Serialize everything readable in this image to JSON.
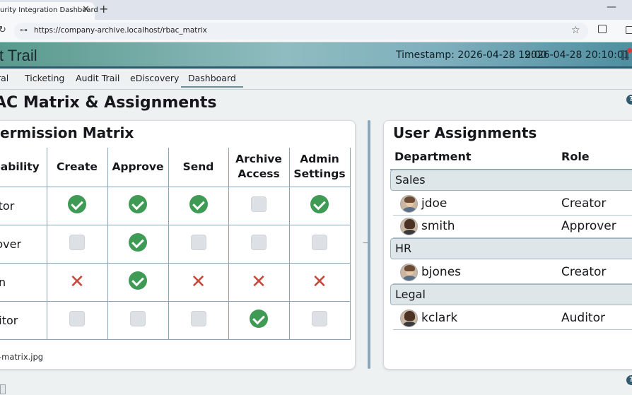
{
  "browser": {
    "tab_title": "urity Integration Dashboard",
    "tab_close": "✕",
    "new_tab": "+",
    "minimize": "—",
    "reload": "↻",
    "url": "https://company-archive.localhost/rbac_matrix",
    "site_icon": "⊶",
    "bookmark": "☆"
  },
  "header": {
    "title": "it Trail",
    "timestamp_label": "Timestamp: 2026-04-28 19:00",
    "timestamp_now": "2026-04-28 20:10:01"
  },
  "nav": {
    "tabs": [
      {
        "label": "ral"
      },
      {
        "label": "Ticketing"
      },
      {
        "label": "Audit Trail"
      },
      {
        "label": "eDiscovery"
      },
      {
        "label": "Dashboard"
      }
    ]
  },
  "page": {
    "title": "AC Matrix & Assignments",
    "help": "?"
  },
  "matrix": {
    "title": "ermission Matrix",
    "headers": [
      "pability",
      "Create",
      "Approve",
      "Send",
      "Archive Access",
      "Admin Settings"
    ],
    "rows": [
      {
        "label": "eator",
        "cells": [
          "ok",
          "ok",
          "ok",
          "na",
          "ok"
        ]
      },
      {
        "label": "prover",
        "cells": [
          "na",
          "ok",
          "na",
          "na",
          "na"
        ]
      },
      {
        "label": "min",
        "cells": [
          "no",
          "ok",
          "no",
          "no",
          "no"
        ]
      },
      {
        "label": "uditor",
        "cells": [
          "na",
          "na",
          "na",
          "ok",
          "na"
        ]
      }
    ],
    "file_label": "-matrix.jpg"
  },
  "assignments": {
    "title": "User Assignments",
    "col_department": "Department",
    "col_role": "Role",
    "groups": [
      {
        "name": "Sales",
        "users": [
          {
            "name": "jdoe",
            "role": "Creator",
            "avatar": "male-avatar"
          },
          {
            "name": "smith",
            "role": "Approver",
            "avatar": "female-avatar"
          }
        ]
      },
      {
        "name": "HR",
        "users": [
          {
            "name": "bjones",
            "role": "Creator",
            "avatar": "male-avatar"
          }
        ]
      },
      {
        "name": "Legal",
        "users": [
          {
            "name": "kclark",
            "role": "Auditor",
            "avatar": "female-avatar"
          }
        ]
      }
    ]
  },
  "colors": {
    "accent": "#2f5870",
    "check": "#3e9a55",
    "deny": "#c8473a",
    "grid": "#8aa4b4"
  }
}
